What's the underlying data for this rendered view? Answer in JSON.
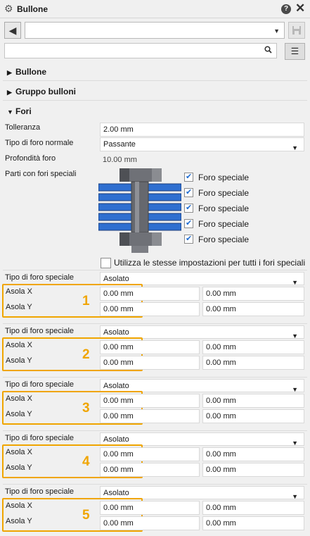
{
  "window": {
    "title": "Bullone",
    "help": "?",
    "close": "✕"
  },
  "toolbar": {
    "back": "◀",
    "combo_value": "",
    "combo_arrow": "▼",
    "save": "💾"
  },
  "search": {
    "placeholder": "",
    "icon": "search-icon",
    "menu": "☰"
  },
  "sections": {
    "bullone": "Bullone",
    "gruppo": "Gruppo bulloni",
    "fori": "Fori"
  },
  "fori": {
    "tolleranza_label": "Tolleranza",
    "tolleranza_value": "2.00 mm",
    "tipo_foro_normale_label": "Tipo di foro normale",
    "tipo_foro_normale_value": "Passante",
    "profondita_label": "Profondità foro",
    "profondita_value": "10.00 mm",
    "parti_label": "Parti con fori speciali",
    "special_holes": [
      {
        "label": "Foro speciale",
        "checked": true
      },
      {
        "label": "Foro speciale",
        "checked": true
      },
      {
        "label": "Foro speciale",
        "checked": true
      },
      {
        "label": "Foro speciale",
        "checked": true
      },
      {
        "label": "Foro speciale",
        "checked": true
      }
    ],
    "utilizza_label": "Utilizza le stesse impostazioni per tutti i fori speciali",
    "utilizza_checked": false
  },
  "holes": [
    {
      "number": "1",
      "tipo_label": "Tipo di foro speciale",
      "tipo_value": "Asolato",
      "asola_x_label": "Asola X",
      "asola_y_label": "Asola Y",
      "x1": "0.00 mm",
      "x2": "0.00 mm",
      "y1": "0.00 mm",
      "y2": "0.00 mm"
    },
    {
      "number": "2",
      "tipo_label": "Tipo di foro speciale",
      "tipo_value": "Asolato",
      "asola_x_label": "Asola X",
      "asola_y_label": "Asola Y",
      "x1": "0.00 mm",
      "x2": "0.00 mm",
      "y1": "0.00 mm",
      "y2": "0.00 mm"
    },
    {
      "number": "3",
      "tipo_label": "Tipo di foro speciale",
      "tipo_value": "Asolato",
      "asola_x_label": "Asola X",
      "asola_y_label": "Asola Y",
      "x1": "0.00 mm",
      "x2": "0.00 mm",
      "y1": "0.00 mm",
      "y2": "0.00 mm"
    },
    {
      "number": "4",
      "tipo_label": "Tipo di foro speciale",
      "tipo_value": "Asolato",
      "asola_x_label": "Asola X",
      "asola_y_label": "Asola Y",
      "x1": "0.00 mm",
      "x2": "0.00 mm",
      "y1": "0.00 mm",
      "y2": "0.00 mm"
    },
    {
      "number": "5",
      "tipo_label": "Tipo di foro speciale",
      "tipo_value": "Asolato",
      "asola_x_label": "Asola X",
      "asola_y_label": "Asola Y",
      "x1": "0.00 mm",
      "x2": "0.00 mm",
      "y1": "0.00 mm",
      "y2": "0.00 mm"
    }
  ],
  "colors": {
    "accent_orange": "#f0a500",
    "plate_blue": "#2f6fd0",
    "bolt_gray": "#6f7177"
  }
}
